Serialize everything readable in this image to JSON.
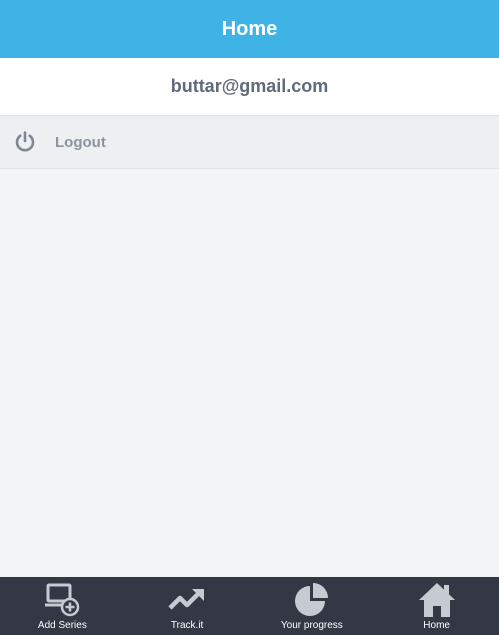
{
  "header": {
    "title": "Home"
  },
  "account": {
    "email": "buttar@gmail.com"
  },
  "menu": {
    "logout_label": "Logout",
    "logout_icon": "power-icon"
  },
  "tabbar": {
    "tabs": [
      {
        "label": "Add Series",
        "icon": "laptop-add-icon"
      },
      {
        "label": "Track.it",
        "icon": "trend-up-icon"
      },
      {
        "label": "Your progress",
        "icon": "pie-chart-icon"
      },
      {
        "label": "Home",
        "icon": "home-icon"
      }
    ]
  },
  "colors": {
    "header_bg": "#3fb3e5",
    "tabbar_bg": "#333844",
    "icon_gray": "#c6cbd2"
  }
}
